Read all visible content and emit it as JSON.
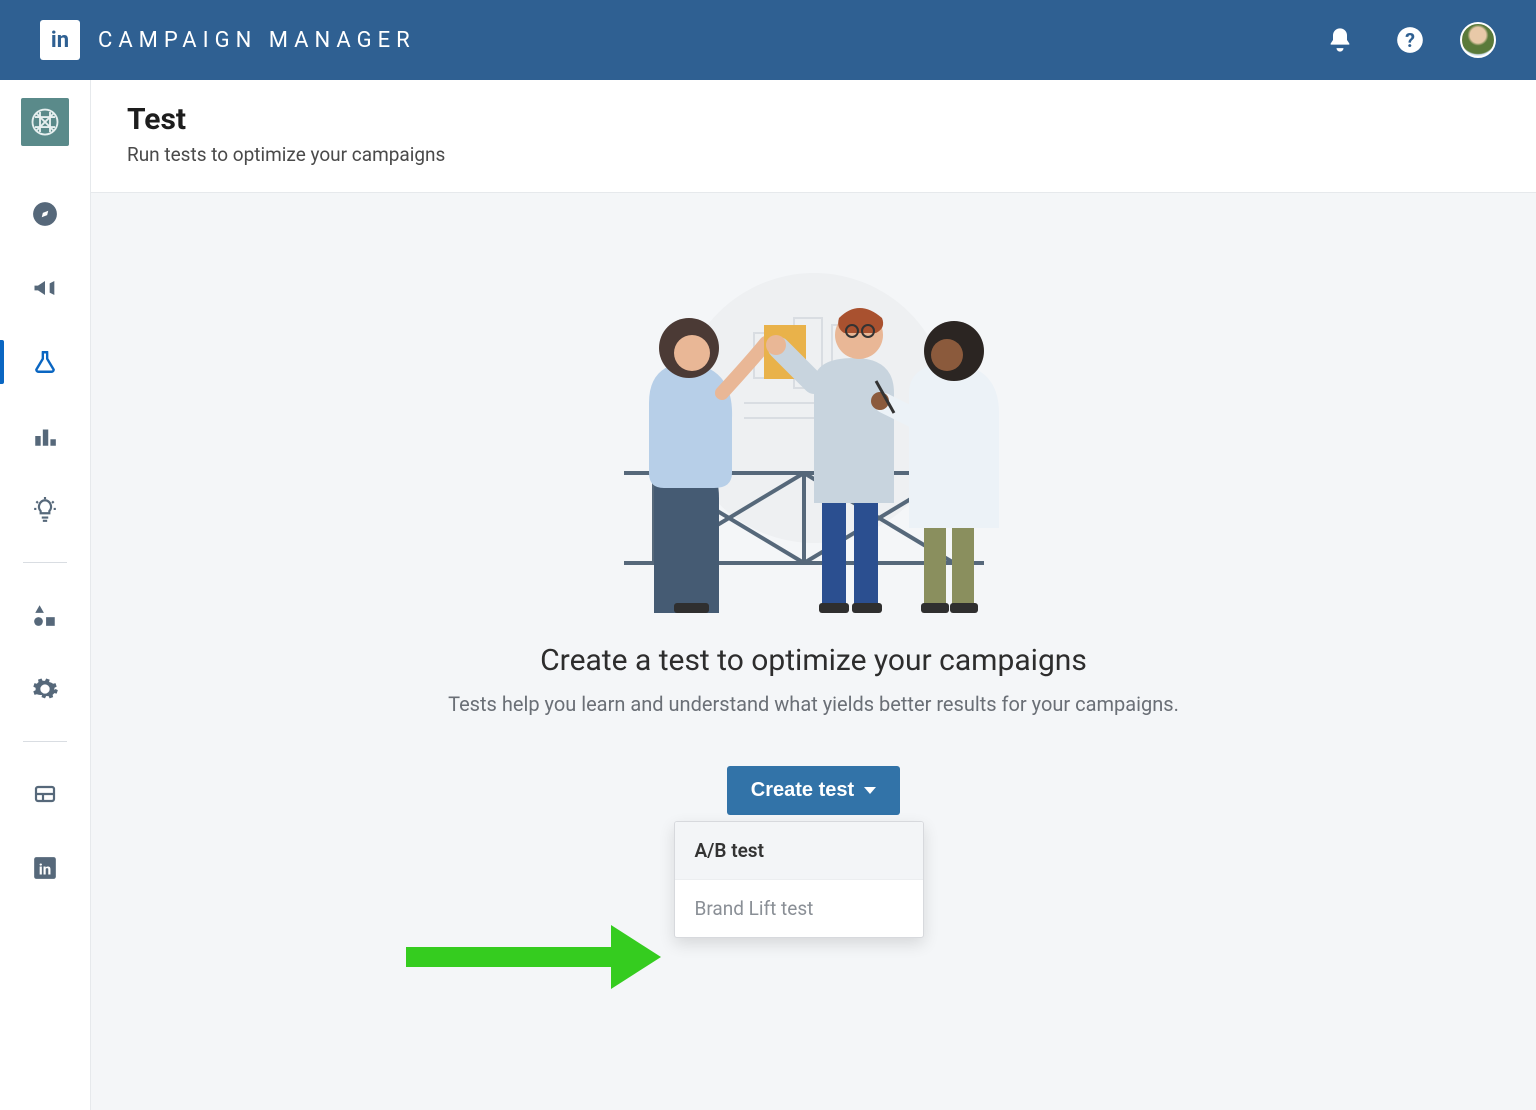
{
  "header": {
    "logo_text": "in",
    "app_title": "CAMPAIGN MANAGER"
  },
  "sidebar": {
    "icons": [
      {
        "name": "compass-icon"
      },
      {
        "name": "megaphone-icon"
      },
      {
        "name": "flask-icon",
        "active": true
      },
      {
        "name": "bar-chart-icon"
      },
      {
        "name": "lightbulb-icon"
      },
      {
        "name": "shapes-icon"
      },
      {
        "name": "gear-icon"
      },
      {
        "name": "business-icon"
      },
      {
        "name": "linkedin-icon"
      }
    ]
  },
  "page": {
    "title": "Test",
    "subtitle": "Run tests to optimize your campaigns"
  },
  "empty_state": {
    "heading": "Create a test to optimize your campaigns",
    "subheading": "Tests help you learn and understand what yields better results for your campaigns.",
    "button_label": "Create test",
    "options": [
      {
        "label": "A/B test"
      },
      {
        "label": "Brand Lift test"
      }
    ]
  }
}
